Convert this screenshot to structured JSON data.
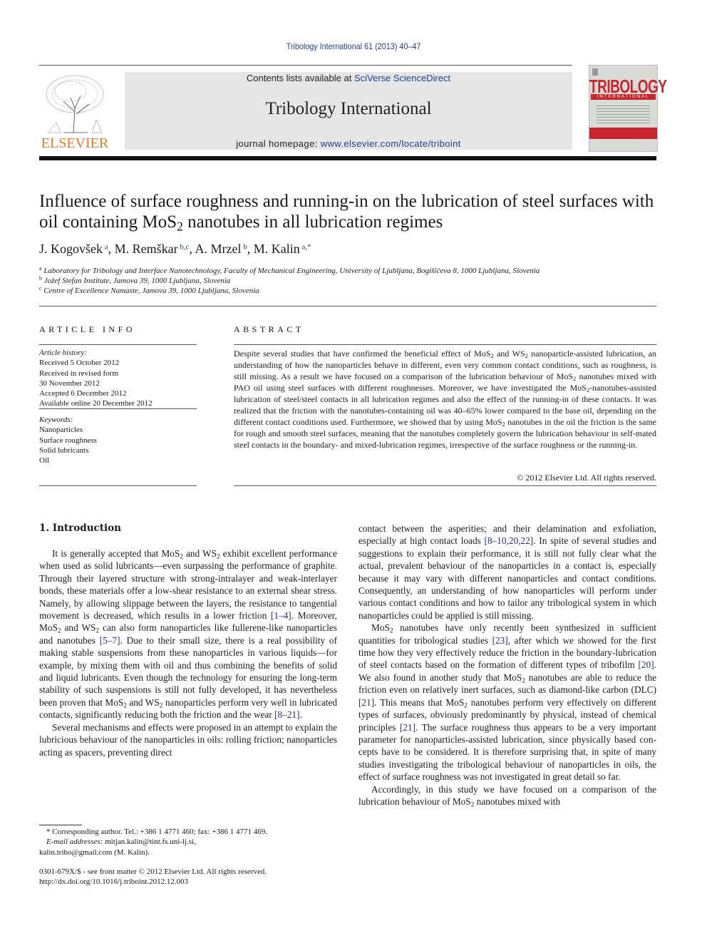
{
  "header": {
    "citation": "Tribology International 61 (2013) 40–47",
    "publisher_logo_text": "ELSEVIER",
    "contents_prefix": "Contents lists available at ",
    "contents_link": "SciVerse ScienceDirect",
    "journal_title": "Tribology International",
    "homepage_prefix": "journal homepage: ",
    "homepage_link": "www.elsevier.com/locate/triboint",
    "cover_title": "TRIBOLOGY",
    "cover_subtitle": "INTERNATIONAL"
  },
  "article": {
    "title_part1": "Influence of surface roughness and running-in on the lubrication of steel surfaces with oil containing MoS",
    "title_sub": "2",
    "title_part2": " nanotubes in all lubrication regimes",
    "authors": [
      {
        "name": "J. Kogovšek",
        "aff": "a"
      },
      {
        "name": "M. Remškar",
        "aff": "b,c"
      },
      {
        "name": "A. Mrzel",
        "aff": "b"
      },
      {
        "name": "M. Kalin",
        "aff": "a,*"
      }
    ],
    "affiliations": [
      {
        "mark": "a",
        "text": "Laboratory for Tribology and Interface Nanotechnology, Faculty of Mechanical Engineering, University of Ljubljana, Bogišićeva 8, 1000 Ljubljana, Slovenia"
      },
      {
        "mark": "b",
        "text": "Jožef Stefan Institute, Jamova 39, 1000 Ljubljana, Slovenia"
      },
      {
        "mark": "c",
        "text": "Centre of Excellence Namaste, Jamova 39, 1000 Ljubljana, Slovenia"
      }
    ]
  },
  "article_info": {
    "label": "ARTICLE INFO",
    "history_heading": "Article history:",
    "history": [
      "Received 5 October 2012",
      "Received in revised form",
      "30 November 2012",
      "Accepted 6 December 2012",
      "Available online 20 December 2012"
    ],
    "keywords_heading": "Keywords:",
    "keywords": [
      "Nanoparticles",
      "Surface roughness",
      "Solid lubricants",
      "Oil"
    ]
  },
  "abstract": {
    "label": "ABSTRACT",
    "text_html": "Despite several studies that have confirmed the beneficial effect of MoS<sub>2</sub> and WS<sub>2</sub> nanoparticle-assisted lubrication, an understanding of how the nanoparticles behave in different, even very common contact conditions, such as roughness, is still missing. As a result we have focused on a comparison of the lubrication behaviour of MoS<sub>2</sub> nanotubes mixed with PAO oil using steel surfaces with different roughnesses. Moreover, we have investigated the MoS<sub>2</sub>-nanotubes-assisted lubrication of steel/steel contacts in all lubrication regimes and also the effect of the running-in of these contacts. It was realized that the friction with the nanotubes-containing oil was 40–65% lower compared to the base oil, depending on the different contact conditions used. Furthermore, we showed that by using MoS<sub>2</sub> nanotubes in the oil the friction is the same for rough and smooth steel surfaces, meaning that the nanotubes completely govern the lubrication behaviour in self-mated steel contacts in the boundary- and mixed-lubrication regimes, irrespective of the surface roughness or the running-in.",
    "copyright": "© 2012 Elsevier Ltd. All rights reserved."
  },
  "body": {
    "section_heading": "1.  Introduction",
    "left_paragraphs_html": [
      "It is generally accepted that MoS<sub>2</sub> and WS<sub>2</sub> exhibit excellent performance when used as solid lubricants—even surpassing the performance of graphite. Through their layered structure with strong-intralayer and weak-interlayer bonds, these materials offer a low-shear resistance to an external shear stress. Namely, by allowing slippage between the layers, the resistance to tangential movement is decreased, which results in a lower friction <span class=\"ref\">[1–4]</span>. Moreover, MoS<sub>2</sub> and WS<sub>2</sub> can also form nanoparticles like fullerene-like nanoparticles and nanotubes <span class=\"ref\">[5–7]</span>. Due to their small size, there is a real possibility of making stable suspensions from these nanoparticles in various liquids—for example, by mixing them with oil and thus combining the benefits of solid and liquid lubricants. Even though the technology for ensuring the long-term stability of such suspensions is still not fully developed, it has nevertheless been proven that MoS<sub>2</sub> and WS<sub>2</sub> nanoparticles perform very well in lubricated contacts, significantly reducing both the friction and the wear <span class=\"ref\">[8–21]</span>.",
      "Several mechanisms and effects were proposed in an attempt to explain the lubricious behaviour of the nanoparticles in oils: rolling friction; nanoparticles acting as spacers, preventing direct"
    ],
    "right_paragraphs_html": [
      "contact between the asperities; and their delamination and exfoliation, especially at high contact loads <span class=\"ref\">[8–10,20,22]</span>. In spite of several studies and suggestions to explain their performance, it is still not fully clear what the actual, prevalent behaviour of the nanoparticles in a contact is, especially because it may vary with different nanoparticles and contact conditions. Consequently, an understanding of how nanoparticles will perform under various contact conditions and how to tailor any tribological system in which nanoparticles could be applied is still missing.",
      "MoS<sub>2</sub> nanotubes have only recently been synthesized in sufficient quantities for tribological studies <span class=\"ref\">[23]</span>, after which we showed for the first time how they very effectively reduce the friction in the boundary-lubrication of steel contacts based on the formation of different types of tribofilm <span class=\"ref\">[20]</span>. We also found in another study that MoS<sub>2</sub> nanotubes are able to reduce the friction even on relatively inert surfaces, such as diamond-like carbon (DLC) <span class=\"ref\">[21]</span>. This means that MoS<sub>2</sub> nanotubes perform very effectively on different types of surfaces, obviously predominantly by physical, instead of chemical principles <span class=\"ref\">[21]</span>. The surface roughness thus appears to be a very important parameter for nanoparticles-assisted lubrication, since physically based con-cepts have to be considered. It is therefore surprising that, in spite of many studies investigating the tribological behaviour of nanoparticles in oils, the effect of surface roughness was not investigated in great detail so far.",
      "Accordingly, in this study we have focused on a comparison of the lubrication behaviour of MoS<sub>2</sub> nanotubes mixed with"
    ]
  },
  "footnotes": {
    "corresponding": "* Corresponding author. Tel.: +386 1 4771 460; fax: +386 1 4771 469.",
    "email_label": "E-mail addresses:",
    "email1": "mitjan.kalin@tint.fs.uni-lj.si,",
    "email2": "kalin.tribo@gmail.com (M. Kalin).",
    "frontmatter": "0301-679X/$ - see front matter © 2012 Elsevier Ltd. All rights reserved.",
    "doi": "http://dx.doi.org/10.1016/j.triboint.2012.12.003"
  },
  "colors": {
    "link": "#1f3f99",
    "elsevier_orange": "#e87b1f",
    "cover_red": "#c8262c",
    "banner_gray": "#e6e6e6"
  }
}
